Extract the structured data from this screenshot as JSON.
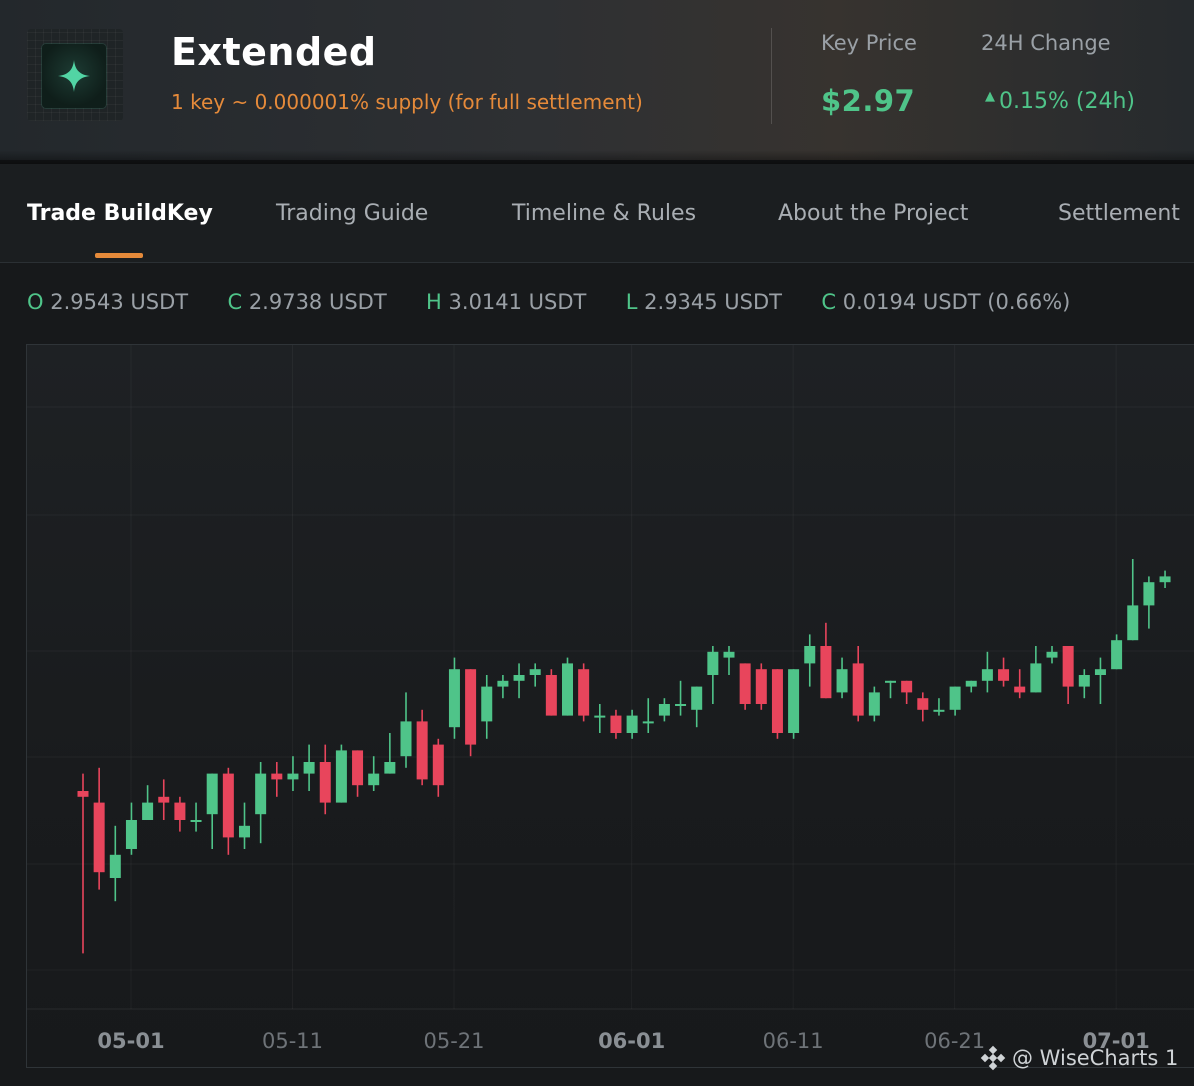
{
  "header": {
    "title": "Extended",
    "subtitle": "1 key ~ 0.000001% supply (for full settlement)",
    "key_price_label": "Key Price",
    "key_price": "$2.97",
    "change_label": "24H Change",
    "change_value": "0.15% (24h)",
    "logo_icon": "sparkle-logo-icon"
  },
  "tabs": [
    {
      "label": "Trade BuildKey",
      "active": true
    },
    {
      "label": "Trading Guide",
      "active": false
    },
    {
      "label": "Timeline & Rules",
      "active": false
    },
    {
      "label": "About the Project",
      "active": false
    },
    {
      "label": "Settlement",
      "active": false
    }
  ],
  "ohlc": {
    "open_key": "O",
    "open": "2.9543 USDT",
    "close_key": "C",
    "close": "2.9738 USDT",
    "high_key": "H",
    "high": "3.0141 USDT",
    "low_key": "L",
    "low": "2.9345 USDT",
    "change_key": "C",
    "change": "0.0194 USDT (0.66%)"
  },
  "watermark": "@ WiseCharts 1",
  "colors": {
    "up": "#4fc489",
    "down": "#e8455c",
    "accent": "#e58a3a"
  },
  "chart_data": {
    "type": "candlestick",
    "x_ticks": [
      {
        "label": "05-01",
        "bold": true,
        "day": 0
      },
      {
        "label": "05-11",
        "bold": false,
        "day": 10
      },
      {
        "label": "05-21",
        "bold": false,
        "day": 20
      },
      {
        "label": "06-01",
        "bold": true,
        "day": 31
      },
      {
        "label": "06-11",
        "bold": false,
        "day": 41
      },
      {
        "label": "06-21",
        "bold": false,
        "day": 51
      },
      {
        "label": "07-01",
        "bold": true,
        "day": 61
      }
    ],
    "y_range": [
      0,
      100
    ],
    "candles": [
      {
        "o": 30,
        "c": 29,
        "h": 33,
        "l": 2
      },
      {
        "o": 28,
        "c": 16,
        "h": 34,
        "l": 13
      },
      {
        "o": 15,
        "c": 19,
        "h": 24,
        "l": 11
      },
      {
        "o": 20,
        "c": 25,
        "h": 28,
        "l": 19
      },
      {
        "o": 25,
        "c": 28,
        "h": 31,
        "l": 25
      },
      {
        "o": 29,
        "c": 28,
        "h": 32,
        "l": 25
      },
      {
        "o": 28,
        "c": 25,
        "h": 29,
        "l": 23
      },
      {
        "o": 25,
        "c": 25,
        "h": 28,
        "l": 23
      },
      {
        "o": 26,
        "c": 33,
        "h": 33,
        "l": 20
      },
      {
        "o": 33,
        "c": 22,
        "h": 34,
        "l": 19
      },
      {
        "o": 22,
        "c": 24,
        "h": 28,
        "l": 20
      },
      {
        "o": 26,
        "c": 33,
        "h": 35,
        "l": 21
      },
      {
        "o": 33,
        "c": 32,
        "h": 35,
        "l": 29
      },
      {
        "o": 32,
        "c": 33,
        "h": 36,
        "l": 30
      },
      {
        "o": 33,
        "c": 35,
        "h": 38,
        "l": 30
      },
      {
        "o": 35,
        "c": 28,
        "h": 38,
        "l": 26
      },
      {
        "o": 28,
        "c": 37,
        "h": 38,
        "l": 28
      },
      {
        "o": 37,
        "c": 31,
        "h": 37,
        "l": 29
      },
      {
        "o": 31,
        "c": 33,
        "h": 36,
        "l": 30
      },
      {
        "o": 33,
        "c": 35,
        "h": 40,
        "l": 33
      },
      {
        "o": 36,
        "c": 42,
        "h": 47,
        "l": 34
      },
      {
        "o": 42,
        "c": 32,
        "h": 44,
        "l": 31
      },
      {
        "o": 38,
        "c": 31,
        "h": 39,
        "l": 29
      },
      {
        "o": 41,
        "c": 51,
        "h": 53,
        "l": 39
      },
      {
        "o": 51,
        "c": 38,
        "h": 51,
        "l": 36
      },
      {
        "o": 42,
        "c": 48,
        "h": 50,
        "l": 39
      },
      {
        "o": 48,
        "c": 49,
        "h": 50,
        "l": 46
      },
      {
        "o": 49,
        "c": 50,
        "h": 52,
        "l": 46
      },
      {
        "o": 50,
        "c": 51,
        "h": 52,
        "l": 48
      },
      {
        "o": 50,
        "c": 43,
        "h": 51,
        "l": 43
      },
      {
        "o": 43,
        "c": 52,
        "h": 53,
        "l": 43
      },
      {
        "o": 51,
        "c": 43,
        "h": 52,
        "l": 42
      },
      {
        "o": 43,
        "c": 43,
        "h": 45,
        "l": 40
      },
      {
        "o": 43,
        "c": 40,
        "h": 44,
        "l": 39
      },
      {
        "o": 40,
        "c": 43,
        "h": 44,
        "l": 39
      },
      {
        "o": 42,
        "c": 42,
        "h": 46,
        "l": 40
      },
      {
        "o": 43,
        "c": 45,
        "h": 46,
        "l": 42
      },
      {
        "o": 45,
        "c": 45,
        "h": 49,
        "l": 43
      },
      {
        "o": 44,
        "c": 48,
        "h": 48,
        "l": 41
      },
      {
        "o": 50,
        "c": 54,
        "h": 55,
        "l": 45
      },
      {
        "o": 53,
        "c": 54,
        "h": 55,
        "l": 50
      },
      {
        "o": 52,
        "c": 45,
        "h": 52,
        "l": 44
      },
      {
        "o": 51,
        "c": 45,
        "h": 52,
        "l": 44
      },
      {
        "o": 51,
        "c": 40,
        "h": 51,
        "l": 39
      },
      {
        "o": 40,
        "c": 51,
        "h": 51,
        "l": 39
      },
      {
        "o": 52,
        "c": 55,
        "h": 57,
        "l": 48
      },
      {
        "o": 55,
        "c": 46,
        "h": 59,
        "l": 46
      },
      {
        "o": 47,
        "c": 51,
        "h": 53,
        "l": 46
      },
      {
        "o": 52,
        "c": 43,
        "h": 55,
        "l": 42
      },
      {
        "o": 43,
        "c": 47,
        "h": 48,
        "l": 42
      },
      {
        "o": 49,
        "c": 49,
        "h": 49,
        "l": 46
      },
      {
        "o": 49,
        "c": 47,
        "h": 49,
        "l": 45
      },
      {
        "o": 46,
        "c": 44,
        "h": 47,
        "l": 42
      },
      {
        "o": 44,
        "c": 44,
        "h": 46,
        "l": 43
      },
      {
        "o": 44,
        "c": 48,
        "h": 48,
        "l": 43
      },
      {
        "o": 48,
        "c": 49,
        "h": 49,
        "l": 47
      },
      {
        "o": 49,
        "c": 51,
        "h": 54,
        "l": 47
      },
      {
        "o": 51,
        "c": 49,
        "h": 53,
        "l": 48
      },
      {
        "o": 48,
        "c": 47,
        "h": 51,
        "l": 46
      },
      {
        "o": 47,
        "c": 52,
        "h": 55,
        "l": 47
      },
      {
        "o": 53,
        "c": 54,
        "h": 55,
        "l": 52
      },
      {
        "o": 55,
        "c": 48,
        "h": 55,
        "l": 45
      },
      {
        "o": 48,
        "c": 50,
        "h": 51,
        "l": 46
      },
      {
        "o": 50,
        "c": 51,
        "h": 53,
        "l": 45
      },
      {
        "o": 51,
        "c": 56,
        "h": 57,
        "l": 51
      },
      {
        "o": 56,
        "c": 62,
        "h": 70,
        "l": 56
      },
      {
        "o": 62,
        "c": 66,
        "h": 67,
        "l": 58
      },
      {
        "o": 66,
        "c": 67,
        "h": 68,
        "l": 65
      }
    ]
  }
}
